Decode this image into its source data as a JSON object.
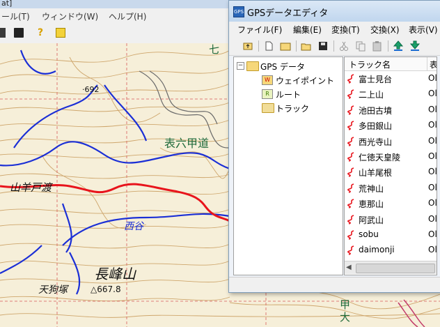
{
  "background_app": {
    "title_fragment": "at]",
    "menu": [
      "ール(T)",
      "ウィンドウ(W)",
      "ヘルプ(H)"
    ]
  },
  "map": {
    "labels": {
      "peak_elevation": "·692",
      "road": "表六甲道",
      "pass": "山羊戸渡",
      "valley": "西谷",
      "mountain": "長峰山",
      "summit": "天狗塚",
      "summit_elev": "△667.8",
      "lower_right": "甲大",
      "top_fragment": "七"
    }
  },
  "gps_window": {
    "title": "GPSデータエディタ",
    "menu": [
      "ファイル(F)",
      "編集(E)",
      "変換(T)",
      "交換(X)",
      "表示(V)"
    ],
    "tree": {
      "root": "GPS データ",
      "children": [
        {
          "label": "ウェイポイント",
          "icon_letter": "W"
        },
        {
          "label": "ルート",
          "icon_letter": "R"
        },
        {
          "label": "トラック",
          "icon_letter": ""
        }
      ]
    },
    "list": {
      "columns": [
        "トラック名",
        "表"
      ],
      "rows": [
        {
          "name": "富士見台",
          "col2": "Ol"
        },
        {
          "name": "二上山",
          "col2": "Ol"
        },
        {
          "name": "池田古墳",
          "col2": "Ol"
        },
        {
          "name": "多田銀山",
          "col2": "Ol"
        },
        {
          "name": "西光寺山",
          "col2": "Ol"
        },
        {
          "name": "仁徳天皇陵",
          "col2": "Ol"
        },
        {
          "name": "山羊尾根",
          "col2": "Ol"
        },
        {
          "name": "荒神山",
          "col2": "Ol"
        },
        {
          "name": "恵那山",
          "col2": "Ol"
        },
        {
          "name": "阿武山",
          "col2": "Ol"
        },
        {
          "name": "sobu",
          "col2": "Ol"
        },
        {
          "name": "daimonji",
          "col2": "Ol"
        }
      ]
    }
  },
  "colors": {
    "track_red": "#e8141c",
    "river_blue": "#1b2fd6",
    "contour_brown": "#c89a5a",
    "road_green": "#1f6a3a"
  }
}
